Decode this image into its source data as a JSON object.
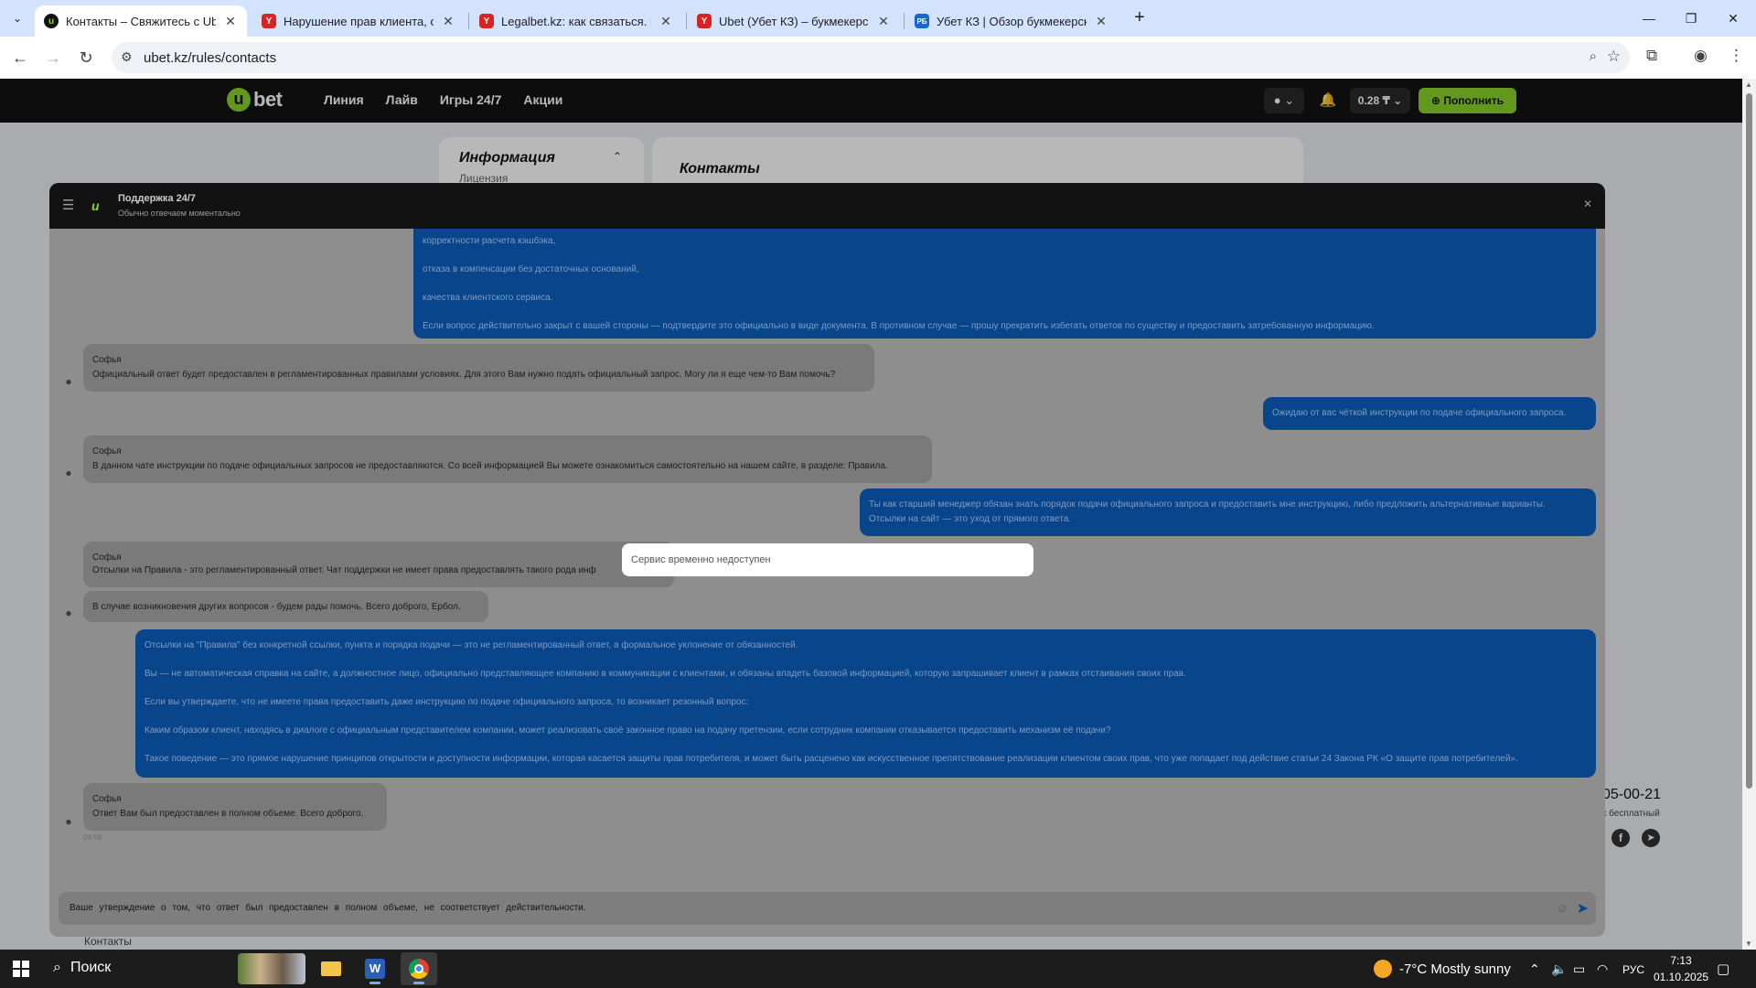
{
  "browser": {
    "tabs": [
      {
        "title": "Контакты – Свяжитесь с Ubet",
        "active": true,
        "favicon": "ubet",
        "color": "#121212"
      },
      {
        "title": "Нарушение прав клиента, отк",
        "active": false,
        "favicon": "Y",
        "color": "#d92222"
      },
      {
        "title": "Legalbet.kz: как связаться. Кон",
        "active": false,
        "favicon": "Y",
        "color": "#d92222"
      },
      {
        "title": "Ubet (Убет КЗ) – букмекерска",
        "active": false,
        "favicon": "Y",
        "color": "#d92222"
      },
      {
        "title": "Убет КЗ | Обзор букмекерской",
        "active": false,
        "favicon": "РБ",
        "color": "#1769d2"
      }
    ],
    "url": "ubet.kz/rules/contacts"
  },
  "site": {
    "logo_u": "u",
    "logo_text": "bet",
    "nav": [
      "Линия",
      "Лайв",
      "Игры 24/7",
      "Акции"
    ],
    "balance": "0.28 ₸",
    "deposit_label": "Пополнить",
    "info_title": "Информация",
    "info_sub": "Лицензия",
    "contacts_title": "Контакты",
    "bg_date": "05-00-21",
    "bg_free": "к бесплатный",
    "footer_link": "Контакты"
  },
  "chat": {
    "title": "Поддержка 24/7",
    "subtitle": "Обычно отвечаем моментально",
    "messages": {
      "m1_lines": [
        "корректности расчета кэшбэка,",
        "отказа в компенсации без достаточных оснований,",
        "качества клиентского сервиса.",
        "Если вопрос действительно закрыт с вашей стороны — подтвердите это официально в виде документа. В противном случае — прошу прекратить избегать ответов по существу и предоставить затребованную информацию."
      ],
      "m2_author": "Софья",
      "m2_text": "Официальный ответ будет предоставлен в регламентированных правилами условиях. Для этого Вам нужно подать официальный запрос. Могу ли я еще чем-то Вам помочь?",
      "m3_text": "Ожидаю от вас чёткой инструкции по подаче официального запроса.",
      "m4_author": "Софья",
      "m4_text": "В данном чате инструкции по подаче официальных запросов не предоставляются. Со всей информацией Вы можете ознакомиться самостоятельно на нашем сайте, в разделе: Правила.",
      "m5_lines": [
        "Ты как старший менеджер обязан знать порядок подачи официального запроса и предоставить мне инструкцию, либо предложить альтернативные варианты.",
        "Отсылки на сайт — это уход от прямого ответа."
      ],
      "m6_author": "Софья",
      "m6_text": "Отсылки на Правила - это регламентированный ответ. Чат поддержки не имеет права предоставлять такого рода инф",
      "m7_text": "В случае возникновения других вопросов - будем рады помочь. Всего доброго, Ербол.",
      "m8_lines": [
        "Отсылки на \"Правила\" без конкретной ссылки, пункта и порядка подачи — это не регламентированный ответ, а формальное уклонение от обязанностей.",
        "Вы — не автоматическая справка на сайте, а должностное лицо, официально представляющее компанию в коммуникации с клиентами, и обязаны владеть базовой информацией, которую запрашивает клиент в рамках отстаивания своих прав.",
        "Если вы утверждаете, что не имеете права предоставить даже инструкцию по подаче официального запроса, то возникает резонный вопрос:",
        "Каким образом клиент, находясь в диалоге с официальным представителем компании, может реализовать своё законное право на подачу претензии, если сотрудник компании отказывается предоставить механизм её подачи?",
        "Такое поведение — это прямое нарушение принципов открытости и доступности информации, которая касается защиты прав потребителя, и может быть расценено как искусственное препятствование реализации клиентом своих прав, что уже попадает под действие статьи 24 Закона РК «О защите прав потребителей»."
      ],
      "m9_author": "Софья",
      "m9_text": "Ответ Вам был предоставлен в полном объеме. Всего доброго.",
      "m9_time": "04:58"
    },
    "input_value": "Ваше утверждение о том, что ответ был предоставлен в полном объеме, не соответствует действительности.",
    "toast": "Сервис временно недоступен"
  },
  "taskbar": {
    "search_label": "Поиск",
    "weather": "-7°C  Mostly sunny",
    "lang": "РУС",
    "time": "7:13",
    "date": "01.10.2025"
  },
  "colors": {
    "brand_green": "#8bd12a",
    "chat_outgoing": "#08458a",
    "header_dark": "#121212"
  }
}
